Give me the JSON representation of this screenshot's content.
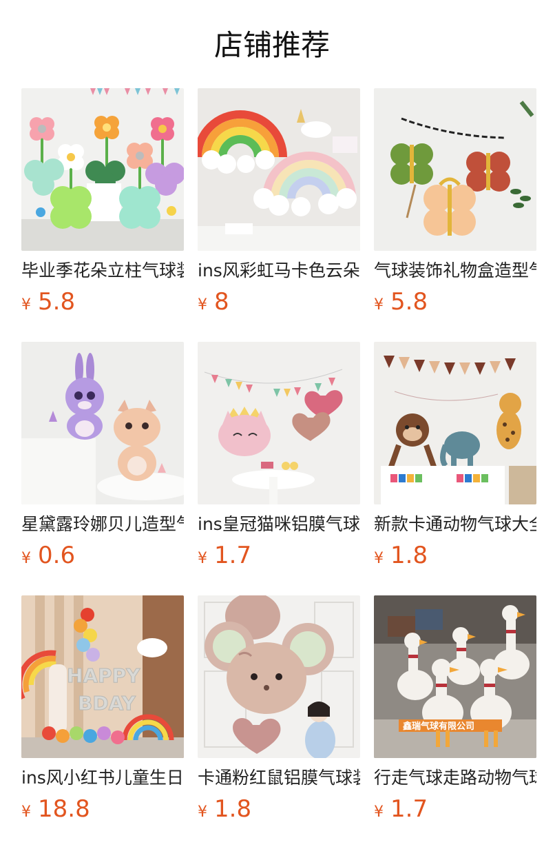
{
  "section": {
    "title": "店铺推荐"
  },
  "currency_symbol": "¥",
  "colors": {
    "price": "#e2551f",
    "title": "#111111",
    "name": "#222222"
  },
  "products": [
    {
      "name": "毕业季花朵立柱气球装饰",
      "price": "5.8",
      "image": "flower-balloon-columns-image"
    },
    {
      "name": "ins风彩虹马卡色云朵气球",
      "price": "8",
      "image": "rainbow-cloud-balloon-image"
    },
    {
      "name": "气球装饰礼物盒造型气球",
      "price": "5.8",
      "image": "gift-box-balloon-image"
    },
    {
      "name": "星黛露玲娜贝儿造型气球",
      "price": "0.6",
      "image": "bunny-fox-foil-balloon-image"
    },
    {
      "name": "ins皇冠猫咪铝膜气球套装",
      "price": "1.7",
      "image": "crown-cat-foil-balloon-image"
    },
    {
      "name": "新款卡通动物气球大全套装",
      "price": "1.8",
      "image": "cartoon-animal-balloon-image"
    },
    {
      "name": "ins风小红书儿童生日气球",
      "price": "18.8",
      "image": "happy-bday-balloon-arch-image"
    },
    {
      "name": "卡通粉红鼠铝膜气球装饰",
      "price": "1.8",
      "image": "pink-mouse-foil-balloon-image"
    },
    {
      "name": "行走气球走路动物气球",
      "price": "1.7",
      "image": "walking-goose-balloon-image"
    }
  ],
  "watermark_text": "鑫瑞气球有限公司"
}
